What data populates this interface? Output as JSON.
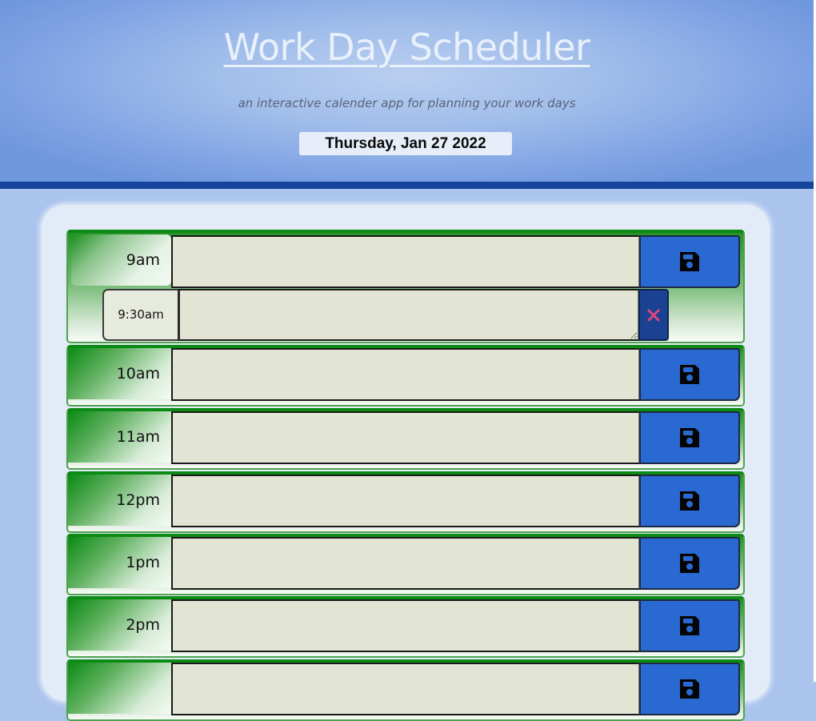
{
  "header": {
    "title": "Work Day Scheduler",
    "subtitle": "an interactive calender app for planning your work days",
    "current_date": "Thursday, Jan 27 2022"
  },
  "rows": [
    {
      "hour": "9am",
      "task": "",
      "save_icon": "floppy-disk-icon",
      "sub_slot": {
        "time": "9:30am",
        "task": "",
        "delete_icon": "close-x-icon"
      }
    },
    {
      "hour": "10am",
      "task": "",
      "save_icon": "floppy-disk-icon"
    },
    {
      "hour": "11am",
      "task": "",
      "save_icon": "floppy-disk-icon"
    },
    {
      "hour": "12pm",
      "task": "",
      "save_icon": "floppy-disk-icon"
    },
    {
      "hour": "1pm",
      "task": "",
      "save_icon": "floppy-disk-icon"
    },
    {
      "hour": "2pm",
      "task": "",
      "save_icon": "floppy-disk-icon"
    },
    {
      "hour": "",
      "task": "",
      "save_icon": "floppy-disk-icon"
    }
  ],
  "colors": {
    "header_bg": "#8fb0e7",
    "header_rule": "#15459b",
    "page_bg": "#aac4ed",
    "container_bg": "#e3ebf8",
    "row_green": "#0b8a14",
    "task_bg": "#e2e5d3",
    "save_button": "#2a69d2",
    "delete_button": "#1b4292",
    "delete_x": "#e0457b"
  }
}
